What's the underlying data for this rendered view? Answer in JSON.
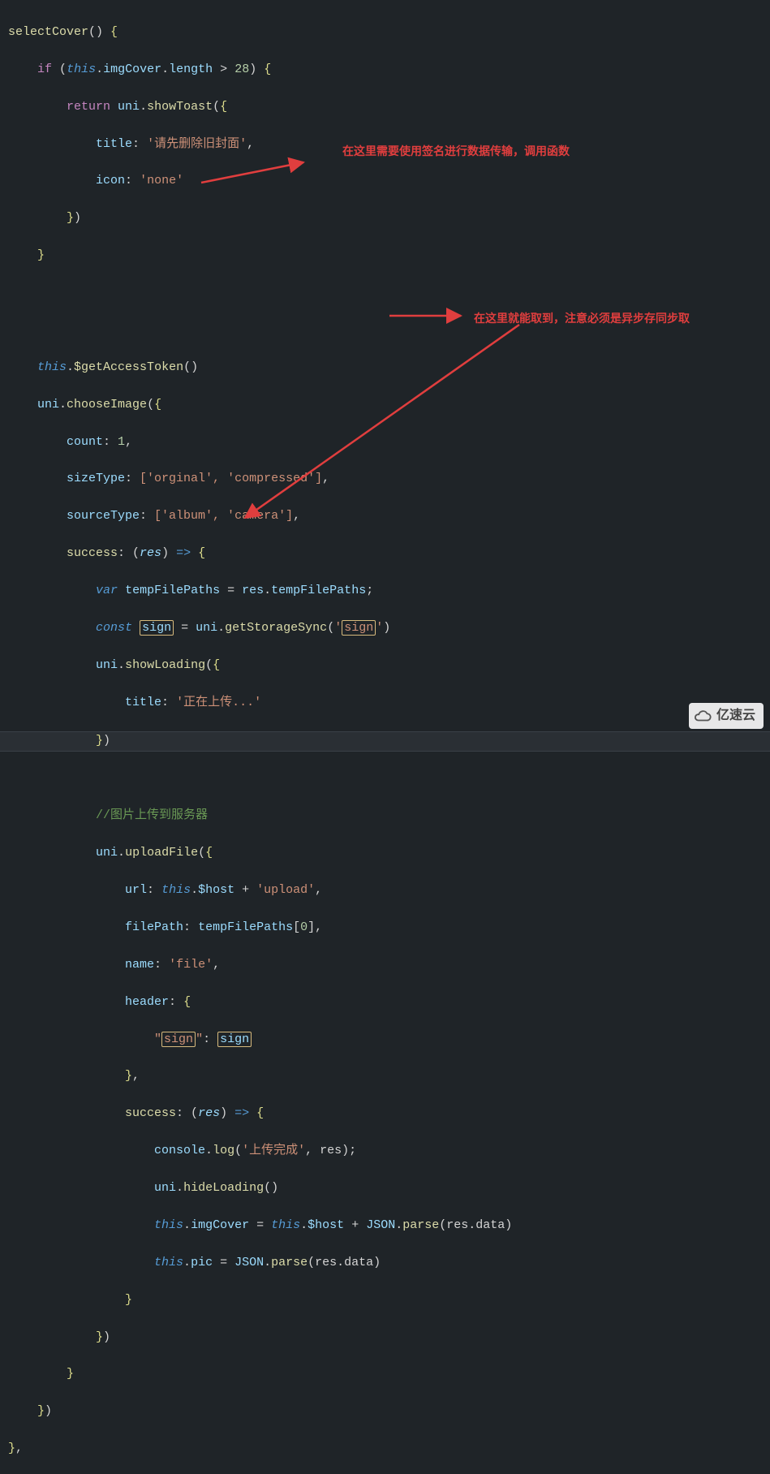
{
  "annotations": {
    "top": "在这里需要使用签名进行数据传输，调用函数",
    "right": "在这里就能取到，注意必须是异步存同步取"
  },
  "watermark": "亿速云",
  "code": {
    "fnName": "selectCover",
    "maxLen": "28",
    "toastTitle": "'请先删除旧封面'",
    "toastIcon": "'none'",
    "tokenCall": "$getAccessToken",
    "chooseImage": "chooseImage",
    "count": "1",
    "sizeType": "['orginal', 'compressed']",
    "sourceType": "['album', 'camera']",
    "tempVar": "tempFilePaths",
    "tempExpr": "res.tempFilePaths",
    "signVar": "sign",
    "storageKey": "'sign'",
    "loadingTitle": "'正在上传...'",
    "uploadComment": "//图片上传到服务器",
    "uploadUrlStr": "'upload'",
    "filePathIdx": "0",
    "nameStr": "'file'",
    "headerKey": "\"sign\"",
    "logStr": "'上传完成'"
  }
}
